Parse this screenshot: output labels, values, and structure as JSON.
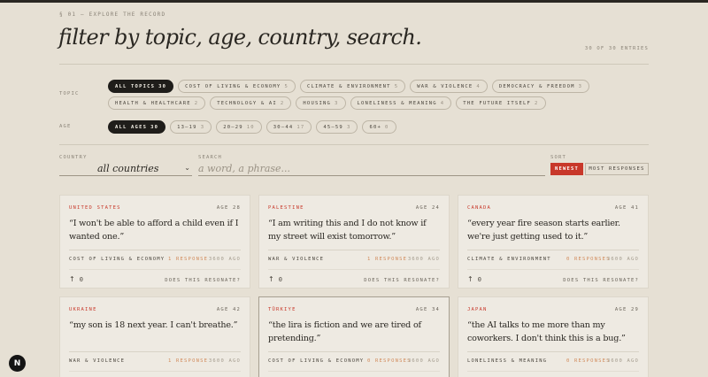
{
  "header": {
    "eyebrow": "§ 01 — EXPLORE THE RECORD",
    "title": "filter by topic, age, country, search.",
    "entries": "30 OF 30 ENTRIES"
  },
  "filters": {
    "topic_label": "TOPIC",
    "topics": [
      {
        "label": "ALL TOPICS",
        "count": "30"
      },
      {
        "label": "COST OF LIVING & ECONOMY",
        "count": "5"
      },
      {
        "label": "CLIMATE & ENVIRONMENT",
        "count": "5"
      },
      {
        "label": "WAR & VIOLENCE",
        "count": "4"
      },
      {
        "label": "DEMOCRACY & FREEDOM",
        "count": "3"
      },
      {
        "label": "HEALTH & HEALTHCARE",
        "count": "2"
      },
      {
        "label": "TECHNOLOGY & AI",
        "count": "2"
      },
      {
        "label": "HOUSING",
        "count": "3"
      },
      {
        "label": "LONELINESS & MEANING",
        "count": "4"
      },
      {
        "label": "THE FUTURE ITSELF",
        "count": "2"
      }
    ],
    "age_label": "AGE",
    "ages": [
      {
        "label": "ALL AGES",
        "count": "30"
      },
      {
        "label": "13–19",
        "count": "3"
      },
      {
        "label": "20–29",
        "count": "10"
      },
      {
        "label": "30–44",
        "count": "17"
      },
      {
        "label": "45–59",
        "count": "3"
      },
      {
        "label": "60+",
        "count": "0"
      }
    ],
    "country_label": "COUNTRY",
    "country_value": "all countries",
    "search_label": "SEARCH",
    "search_placeholder": "a word, a phrase...",
    "sort_label": "SORT",
    "sort_newest": "NEWEST",
    "sort_most": "MOST RESPONSES"
  },
  "cards": [
    {
      "country": "UNITED STATES",
      "age": "AGE 28",
      "quote": "“I won't be able to afford a child even if I wanted one.”",
      "topic": "COST OF LIVING & ECONOMY",
      "responses": "1 RESPONSE",
      "ago": "3600 AGO",
      "votes": "0",
      "resonate": "DOES THIS RESONATE?"
    },
    {
      "country": "PALESTINE",
      "age": "AGE 24",
      "quote": "“I am writing this and I do not know if my street will exist tomorrow.”",
      "topic": "WAR & VIOLENCE",
      "responses": "1 RESPONSE",
      "ago": "3600 AGO",
      "votes": "0",
      "resonate": "DOES THIS RESONATE?"
    },
    {
      "country": "CANADA",
      "age": "AGE 41",
      "quote": "“every year fire season starts earlier. we're just getting used to it.”",
      "topic": "CLIMATE & ENVIRONMENT",
      "responses": "0 RESPONSES",
      "ago": "3600 AGO",
      "votes": "0",
      "resonate": "DOES THIS RESONATE?"
    },
    {
      "country": "UKRAINE",
      "age": "AGE 42",
      "quote": "“my son is 18 next year. I can't breathe.”",
      "topic": "WAR & VIOLENCE",
      "responses": "1 RESPONSE",
      "ago": "3600 AGO",
      "votes": "",
      "resonate": ""
    },
    {
      "country": "TÜRKIYE",
      "age": "AGE 34",
      "quote": "“the lira is fiction and we are tired of pretending.”",
      "topic": "COST OF LIVING & ECONOMY",
      "responses": "0 RESPONSES",
      "ago": "3600 AGO",
      "votes": "",
      "resonate": ""
    },
    {
      "country": "JAPAN",
      "age": "AGE 29",
      "quote": "“the AI talks to me more than my coworkers. I don't think this is a bug.”",
      "topic": "LONELINESS & MEANING",
      "responses": "0 RESPONSES",
      "ago": "3600 AGO",
      "votes": "",
      "resonate": ""
    }
  ],
  "badge": "N"
}
